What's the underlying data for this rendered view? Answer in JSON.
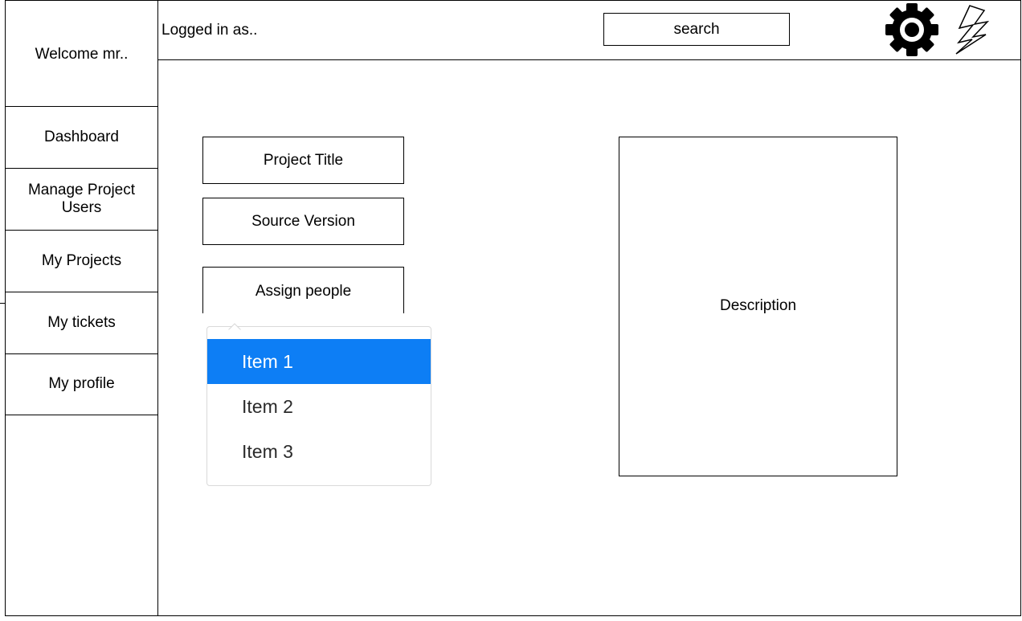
{
  "sidebar": {
    "welcome": "Welcome mr..",
    "items": [
      {
        "label": "Dashboard"
      },
      {
        "label": "Manage Project Users"
      },
      {
        "label": "My Projects"
      },
      {
        "label": "My tickets"
      },
      {
        "label": "My profile"
      }
    ]
  },
  "header": {
    "logged_in": "Logged in as..",
    "search_label": "search",
    "icons": [
      "gear-icon",
      "lightning-icon"
    ]
  },
  "form": {
    "project_title": "Project Title",
    "source_version": "Source Version",
    "assign_people": "Assign people",
    "description": "Description"
  },
  "dropdown": {
    "items": [
      {
        "label": "Item 1",
        "selected": true
      },
      {
        "label": "Item 2",
        "selected": false
      },
      {
        "label": "Item 3",
        "selected": false
      }
    ],
    "accent_color": "#0d7ef5"
  }
}
